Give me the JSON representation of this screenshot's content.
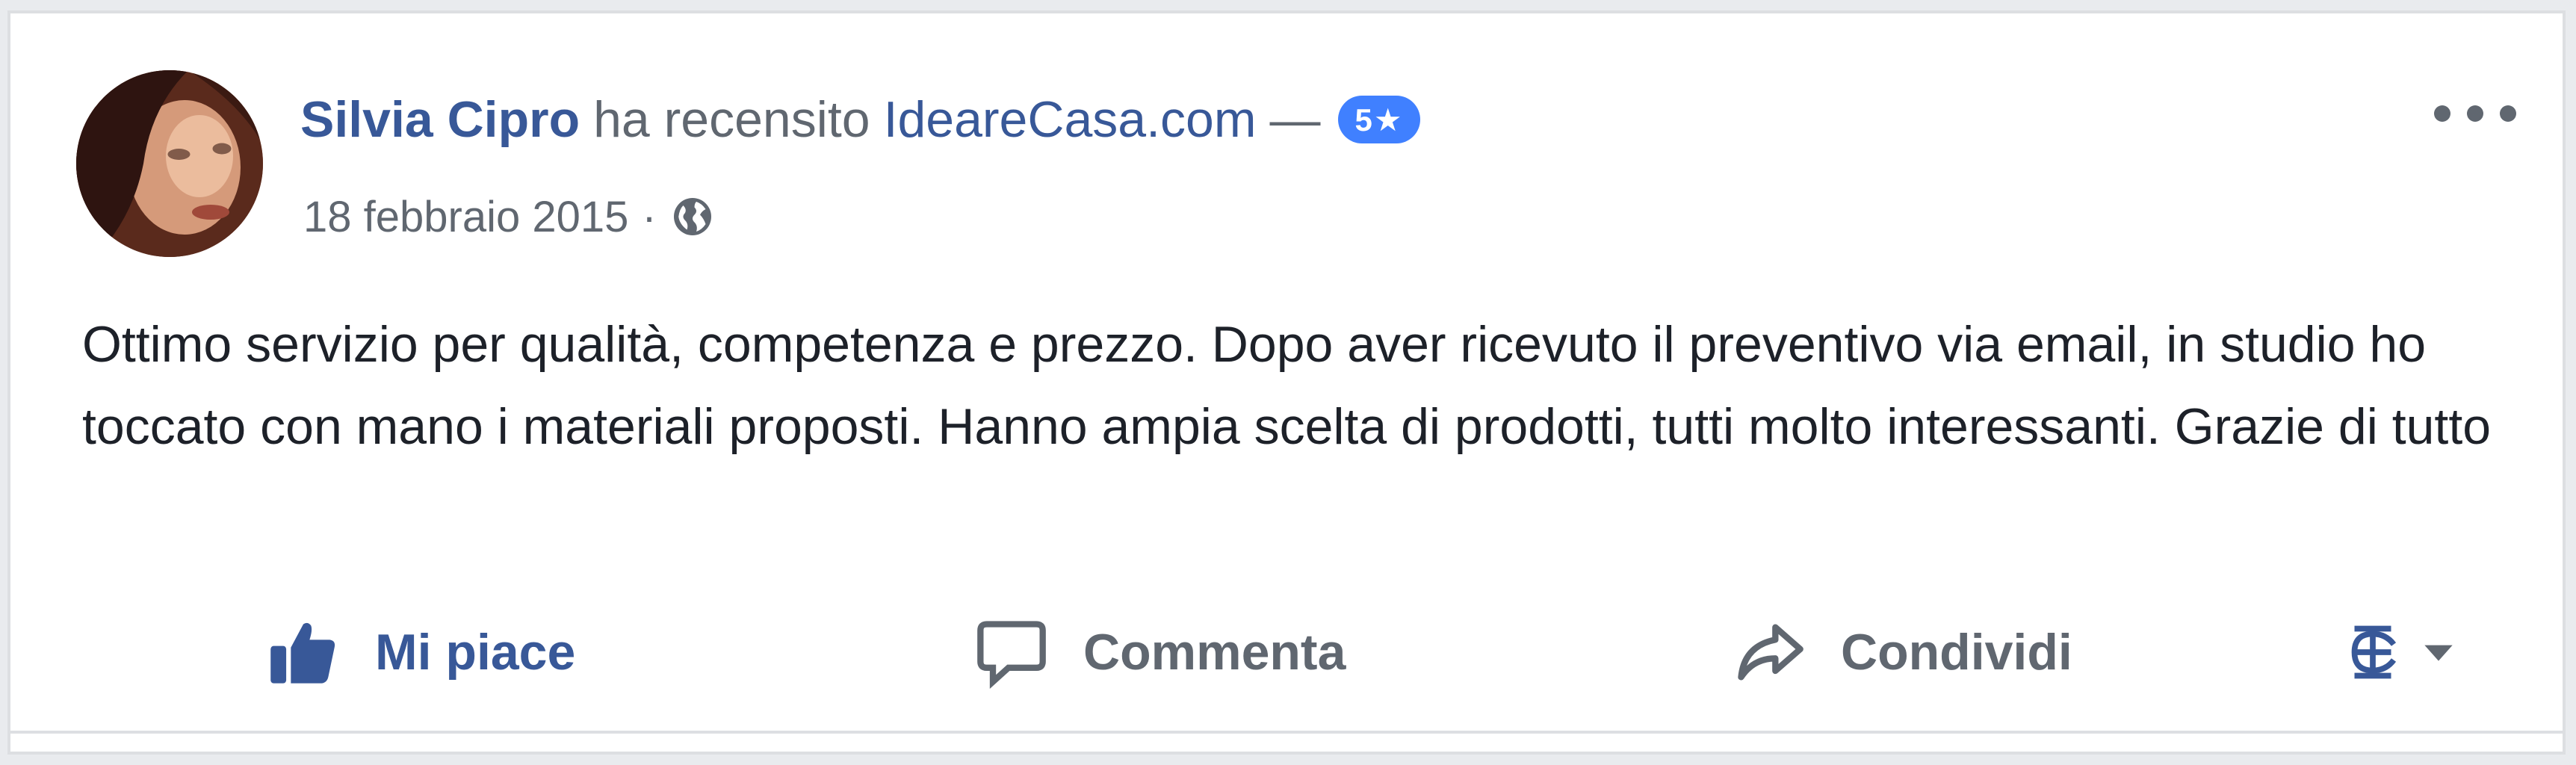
{
  "post": {
    "author": "Silvia Cipro",
    "action_text": "ha recensito",
    "page_name": "IdeareCasa.com",
    "dash": "—",
    "rating_badge": "5★",
    "date": "18 febbraio 2015",
    "separator": "·",
    "privacy_icon": "globe-icon",
    "body": "Ottimo servizio per qualità, competenza e prezzo. Dopo aver ricevuto il preventivo via email, in studio ho toccato con mano i materiali proposti. Hanno ampia scelta di prodotti, tutti molto interessanti. Grazie di tutto"
  },
  "actions": {
    "like_label": "Mi piace",
    "comment_label": "Comment​a",
    "share_label": "Condividi"
  },
  "colors": {
    "link": "#385898",
    "meta": "#606770",
    "badge": "#4080ff",
    "text": "#1d2129"
  }
}
